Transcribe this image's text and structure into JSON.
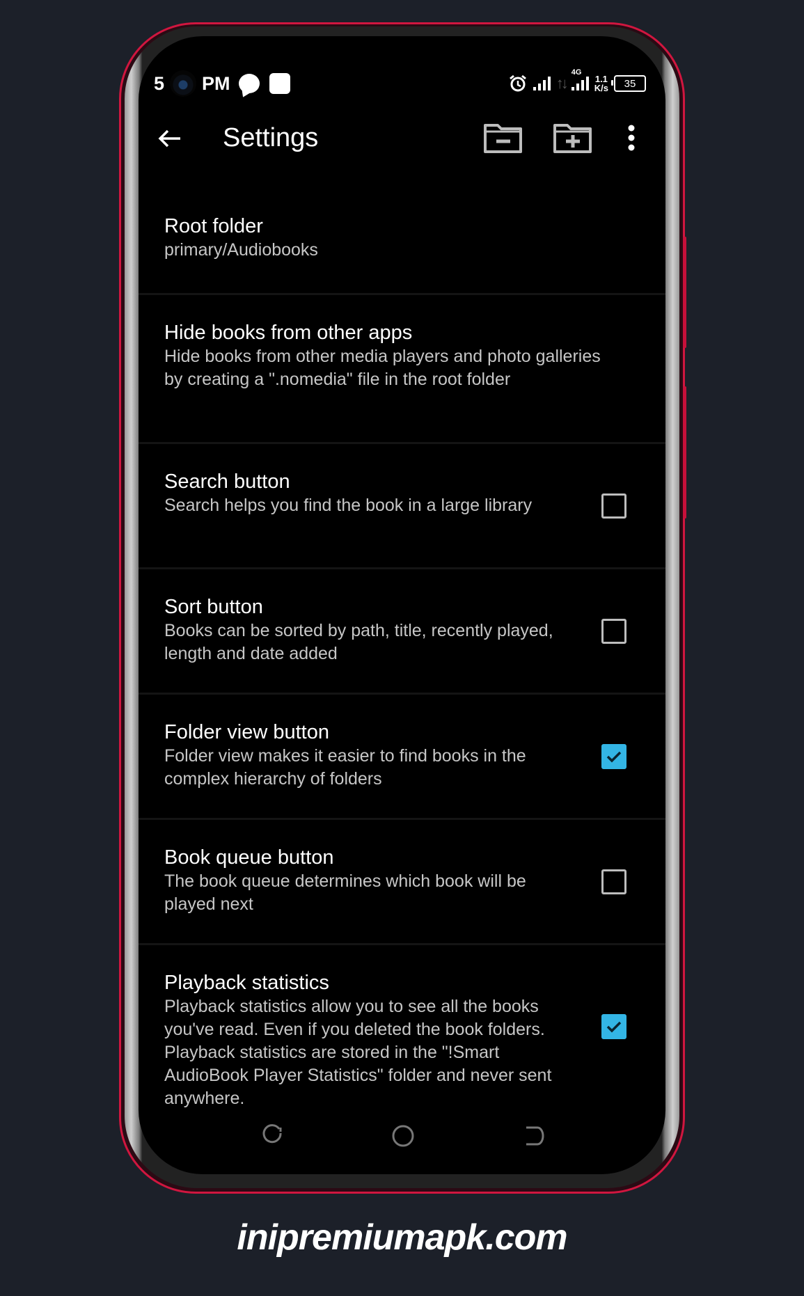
{
  "statusbar": {
    "time_hour": "5",
    "time_period": "PM",
    "network_type": "4G",
    "speed_value": "1.1",
    "speed_unit": "K/s",
    "battery_level": "35",
    "icons": [
      "camera-hole",
      "chat-bubble-icon",
      "notification-square-icon",
      "alarm-icon",
      "signal-icon",
      "data-arrows-icon",
      "signal-4g-icon",
      "battery-icon"
    ]
  },
  "toolbar": {
    "title": "Settings",
    "icons": [
      "back-arrow-icon",
      "folder-remove-icon",
      "folder-add-icon",
      "more-vert-icon"
    ]
  },
  "preferences": [
    {
      "title": "Root folder",
      "summary": "primary/Audiobooks",
      "has_checkbox": false
    },
    {
      "title": "Hide books from other apps",
      "summary": "Hide books from other media players and photo galleries by creating a \".nomedia\" file in the root folder",
      "has_checkbox": false
    },
    {
      "title": "Search button",
      "summary": "Search helps you find the book in a large library",
      "has_checkbox": true,
      "checked": false
    },
    {
      "title": "Sort button",
      "summary": "Books can be sorted by path, title, recently played, length and date added",
      "has_checkbox": true,
      "checked": false
    },
    {
      "title": "Folder view button",
      "summary": "Folder view makes it easier to find books in the complex hierarchy of folders",
      "has_checkbox": true,
      "checked": true
    },
    {
      "title": "Book queue button",
      "summary": "The book queue determines which book will be played next",
      "has_checkbox": true,
      "checked": false
    },
    {
      "title": "Playback statistics",
      "summary": "Playback statistics allow you to see all the books you've read. Even if you deleted the book folders. Playback statistics are stored in the \"!Smart AudioBook Player Statistics\" folder and never sent anywhere.",
      "has_checkbox": true,
      "checked": true
    }
  ],
  "navbar": {
    "icons": [
      "recents-icon",
      "home-icon",
      "back-icon"
    ]
  },
  "watermark": "inipremiumapk.com",
  "colors": {
    "accent": "#33b5e5",
    "phone_frame": "#d0163f",
    "background": "#1c2029"
  }
}
